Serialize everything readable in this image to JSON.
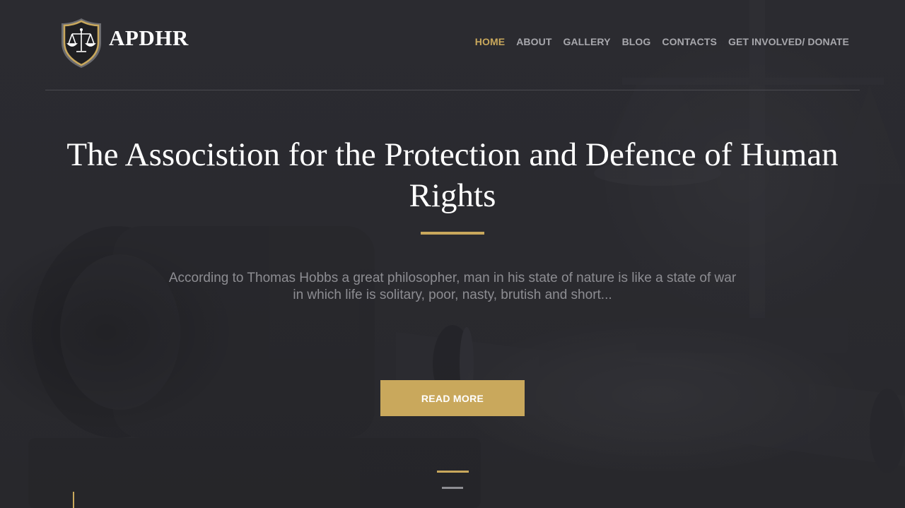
{
  "brand": {
    "name": "APDHR",
    "logo_icon": "scales-of-justice-shield-icon",
    "colors": {
      "accent": "#c9a85c",
      "shield_inner": "#1f1f22",
      "shield_outer": "#6c6c70"
    }
  },
  "nav": {
    "items": [
      {
        "label": "HOME",
        "active": true
      },
      {
        "label": "ABOUT",
        "active": false
      },
      {
        "label": "GALLERY",
        "active": false
      },
      {
        "label": "BLOG",
        "active": false
      },
      {
        "label": "CONTACTS",
        "active": false
      },
      {
        "label": "GET INVOLVED/ DONATE",
        "active": false
      }
    ]
  },
  "hero": {
    "title": "The Associstion for the Protection and Defence of Human Rights",
    "description": "According to Thomas Hobbs a great philosopher, man in his state of nature is like a state of war in which life is solitary, poor, nasty, brutish and short...",
    "button_label": "READ MORE",
    "background_image": "gavel-and-scales"
  },
  "slider": {
    "slide_count": 2,
    "active_index": 0
  },
  "colors": {
    "background": "#2a2a2e",
    "accent": "#c9a85c",
    "nav_text": "#a8a8ad",
    "description_text": "#8d8d92",
    "title_text": "#ffffff"
  }
}
